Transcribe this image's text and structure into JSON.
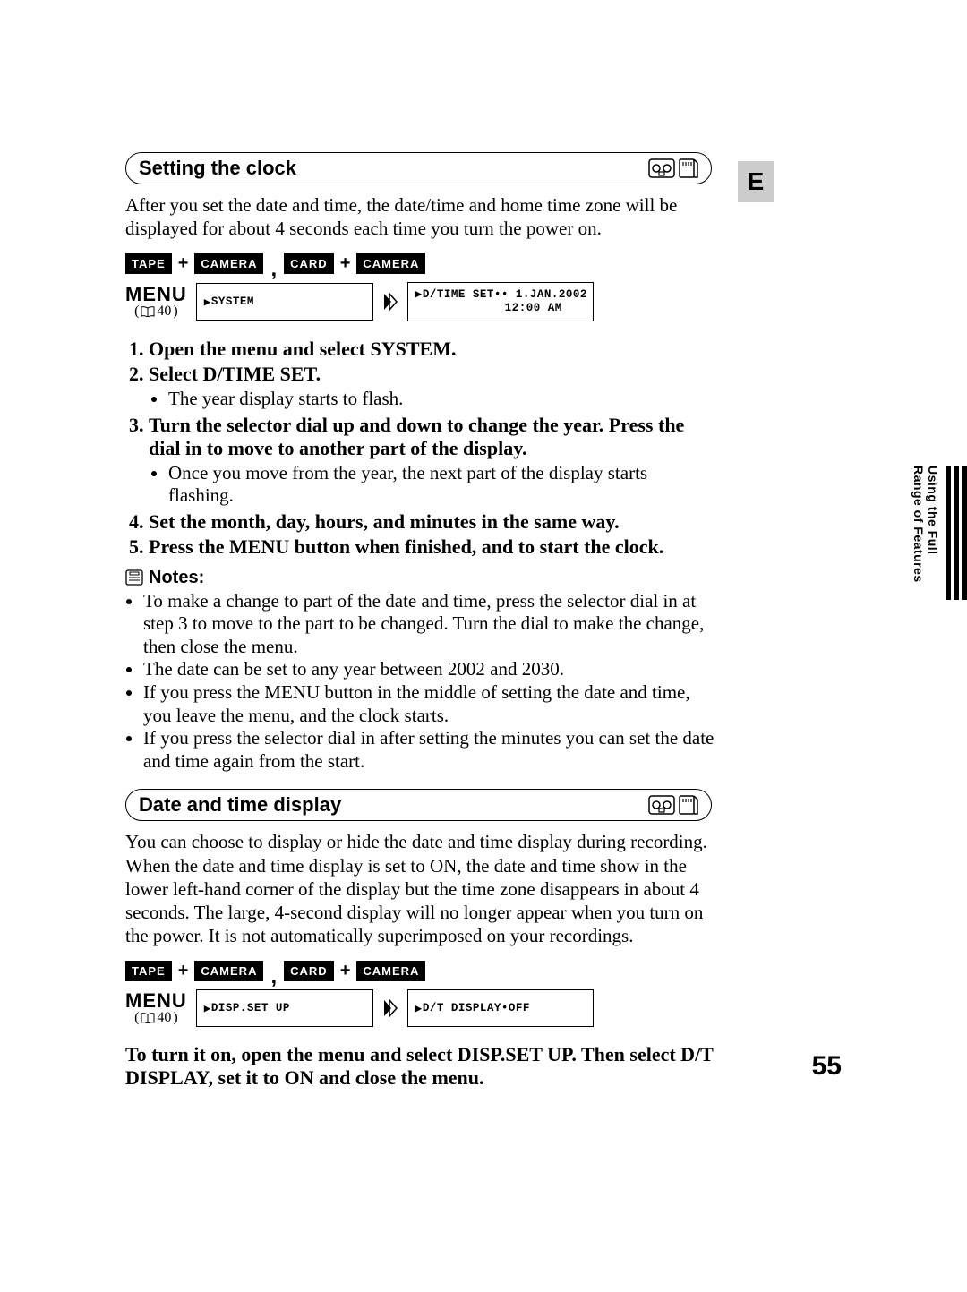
{
  "lang_tab": "E",
  "side_tab": {
    "line1": "Using the Full",
    "line2": "Range of Features"
  },
  "page_number": "55",
  "section1": {
    "heading": "Setting the clock",
    "intro": "After you set the date and time, the date/time and home time zone will be displayed for about 4 seconds each time you turn the power on.",
    "modes": {
      "box1": "TAPE",
      "box2": "CAMERA",
      "sep": ",",
      "box3": "CARD",
      "box4": "CAMERA"
    },
    "menu": {
      "label": "MENU",
      "ref_page": "40",
      "osd1": "SYSTEM",
      "osd2_line1": "D/TIME SET•• 1.JAN.2002",
      "osd2_line2": "12:00 AM"
    },
    "steps": [
      {
        "title": "Open the menu and select SYSTEM."
      },
      {
        "title": "Select D/TIME SET.",
        "bullets": [
          "The year display starts to flash."
        ]
      },
      {
        "title": "Turn the selector dial up and down to change the year. Press the dial in to move to another part of the display.",
        "bullets": [
          "Once you move from the year, the next part of the display starts flashing."
        ]
      },
      {
        "title": "Set the month, day, hours, and minutes in the same way."
      },
      {
        "title": "Press the MENU button when finished, and to start the clock."
      }
    ],
    "notes_heading": "Notes:",
    "notes": [
      "To make a change to part of the date and time, press the selector dial in at step 3 to move to the part to be changed. Turn the dial to make the change, then close the menu.",
      "The date can be set to any year between 2002 and 2030.",
      "If you press the MENU button in the middle of setting the date and time, you leave the menu, and the clock starts.",
      "If you press the selector dial in after setting the minutes you can set the date and time again from the start."
    ]
  },
  "section2": {
    "heading": "Date and time display",
    "intro": "You can choose to display or hide the date and time display during recording. When the date and time display is set to ON, the date and time show in the lower left-hand corner of the display but the time zone disappears in about 4 seconds. The large, 4-second display will no longer appear when you turn on the power. It is not automatically superimposed on your recordings.",
    "modes": {
      "box1": "TAPE",
      "box2": "CAMERA",
      "sep": ",",
      "box3": "CARD",
      "box4": "CAMERA"
    },
    "menu": {
      "label": "MENU",
      "ref_page": "40",
      "osd1": "DISP.SET UP",
      "osd2": "D/T DISPLAY•OFF"
    },
    "closing": "To turn it on, open the menu and select DISP.SET UP. Then select D/T DISPLAY, set it to ON and close the menu."
  }
}
